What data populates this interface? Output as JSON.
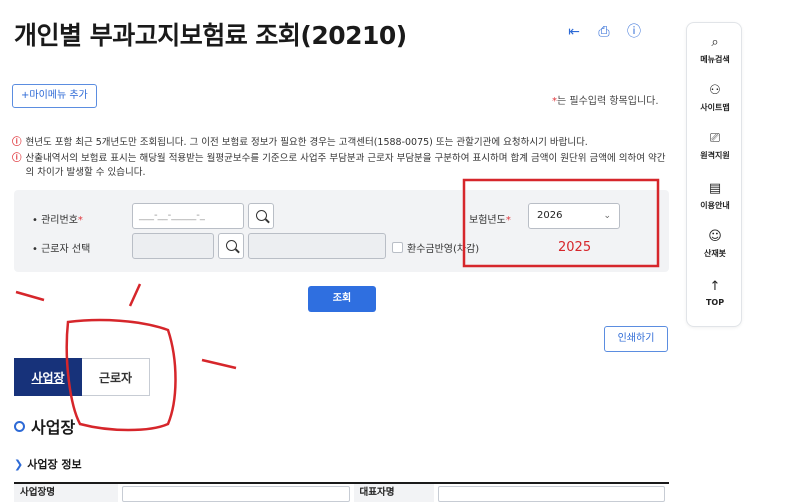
{
  "page": {
    "title": "개인별 부과고지보험료 조회(20210)",
    "mymenu_button": "+마이메뉴 추가",
    "required_star": "*",
    "required_note": "는 필수입력 항목입니다.",
    "print_button": "인쇄하기",
    "query_button": "조회"
  },
  "notices": [
    "현년도 포함 최근 5개년도만 조회됩니다. 그 이전 보험료 정보가 필요한 경우는 고객센터(1588-0075) 또는 관할기관에 요청하시기 바랍니다.",
    "산출내역서의 보험료 표시는 해당월 적용받는 월평균보수를 기준으로 사업주 부담분과 근로자 부담분을 구분하여 표시하며 합계 금액이 원단위 금액에 의하여 약간의 차이가 발생할 수 있습니다."
  ],
  "notice_icon": "!",
  "form": {
    "mgmt_no_label": "관리번호",
    "mgmt_no_placeholder": "___-__-_____-_",
    "insurance_year_label": "보험년도",
    "insurance_year_value": "2026",
    "worker_select_label": "근로자 선택",
    "refund_checkbox_label": "환수금반영(차감)",
    "star": "*",
    "bullet": "•"
  },
  "tabs": [
    {
      "label": "사업장",
      "active": true
    },
    {
      "label": "근로자",
      "active": false
    }
  ],
  "section": {
    "title": "사업장",
    "subtitle": "사업장 정보"
  },
  "table": {
    "col1": "사업장명",
    "col2": "대표자명"
  },
  "sidebar": [
    {
      "label": "메뉴검색",
      "icon": "search-icon"
    },
    {
      "label": "사이트맵",
      "icon": "sitemap-icon"
    },
    {
      "label": "원격지원",
      "icon": "remote-support-icon"
    },
    {
      "label": "이용안내",
      "icon": "guide-icon"
    },
    {
      "label": "산재봇",
      "icon": "chatbot-icon"
    },
    {
      "label": "TOP",
      "icon": "arrow-up-icon"
    }
  ],
  "annotation": {
    "text": "2025",
    "color": "#d6262b"
  },
  "colors": {
    "accent": "#2f6fe0",
    "tab_active": "#17327a",
    "warning": "#e0383e"
  }
}
